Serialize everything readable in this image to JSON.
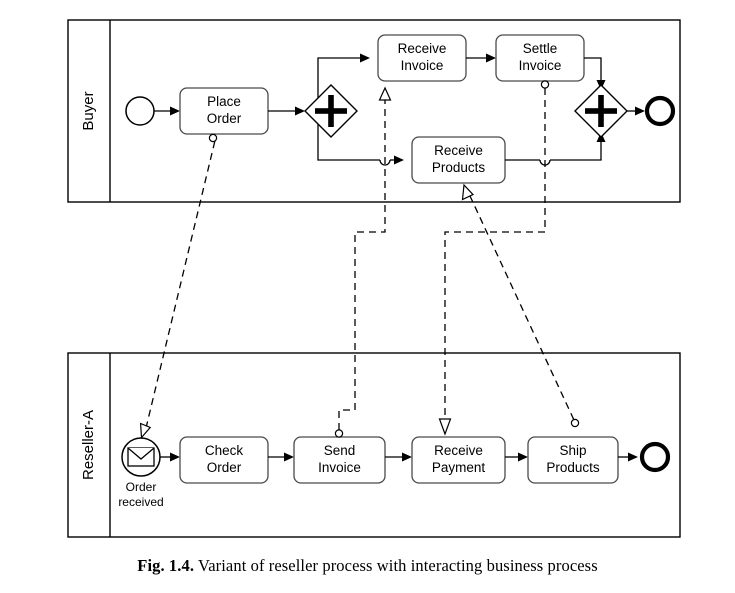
{
  "figure": {
    "caption_number": "Fig. 1.4.",
    "caption_text": "Variant of reseller process with interacting business process"
  },
  "pools": [
    {
      "id": "buyer",
      "label": "Buyer"
    },
    {
      "id": "reseller-a",
      "label": "Reseller-A"
    }
  ],
  "buyer_pool": {
    "label": "Buyer",
    "start_event": {
      "name": "start-event",
      "label": ""
    },
    "tasks": [
      {
        "id": "place-order",
        "line1": "Place",
        "line2": "Order"
      },
      {
        "id": "receive-invoice",
        "line1": "Receive",
        "line2": "Invoice"
      },
      {
        "id": "settle-invoice",
        "line1": "Settle",
        "line2": "Invoice"
      },
      {
        "id": "receive-products",
        "line1": "Receive",
        "line2": "Products"
      }
    ],
    "gateways": [
      {
        "id": "parallel-split",
        "type": "parallel",
        "symbol": "+"
      },
      {
        "id": "parallel-join",
        "type": "parallel",
        "symbol": "+"
      }
    ],
    "end_event": {
      "name": "end-event",
      "label": ""
    }
  },
  "reseller_pool": {
    "label": "Reseller-A",
    "start_event": {
      "name": "message-start-event",
      "icon": "envelope-icon",
      "caption_line1": "Order",
      "caption_line2": "received"
    },
    "tasks": [
      {
        "id": "check-order",
        "line1": "Check",
        "line2": "Order"
      },
      {
        "id": "send-invoice",
        "line1": "Send",
        "line2": "Invoice"
      },
      {
        "id": "receive-payment",
        "line1": "Receive",
        "line2": "Payment"
      },
      {
        "id": "ship-products",
        "line1": "Ship",
        "line2": "Products"
      }
    ],
    "end_event": {
      "name": "end-event",
      "label": ""
    }
  },
  "message_flows": [
    {
      "id": "place-order-to-order-received",
      "from": "place-order",
      "to": "message-start-event"
    },
    {
      "id": "send-invoice-to-receive-invoice",
      "from": "send-invoice",
      "to": "receive-invoice"
    },
    {
      "id": "settle-invoice-to-receive-payment",
      "from": "settle-invoice",
      "to": "receive-payment"
    },
    {
      "id": "ship-products-to-receive-products",
      "from": "ship-products",
      "to": "receive-products"
    }
  ],
  "colors": {
    "stroke": "#000000",
    "task_border": "#4a4a4a",
    "background": "#ffffff"
  }
}
